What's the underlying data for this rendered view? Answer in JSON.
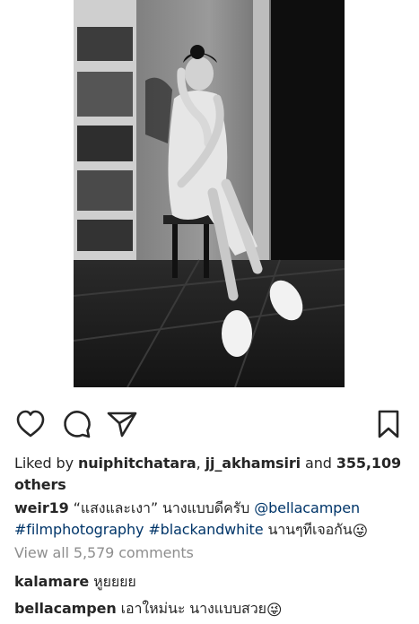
{
  "post": {
    "likes": {
      "prefix": "Liked by ",
      "user1": "nuiphitchatara",
      "sep": ", ",
      "user2": "jj_akhamsiri",
      "and": " and ",
      "count": "355,109",
      "others": "others"
    },
    "caption": {
      "username": "weir19",
      "text": " “แสงและเงา” นางแบบดีครับ ",
      "mention": "@bellacampen",
      "hashtag1": "#filmphotography",
      "hashtag2": "#blackandwhite",
      "text2": " นานๆทีเจอกัน",
      "emoji": "😜"
    },
    "view_all": "View all 5,579 comments",
    "comments": [
      {
        "username": "kalamare",
        "text": " หูยยยย",
        "emoji": ""
      },
      {
        "username": "bellacampen",
        "text": " เอาใหม่นะ นางแบบสวย",
        "emoji": "😜"
      }
    ]
  },
  "icons": {
    "like": "heart-icon",
    "comment": "comment-icon",
    "share": "paper-plane-icon",
    "save": "bookmark-icon"
  },
  "colors": {
    "text": "#262626",
    "link": "#003569",
    "muted": "#8e8e8e"
  }
}
